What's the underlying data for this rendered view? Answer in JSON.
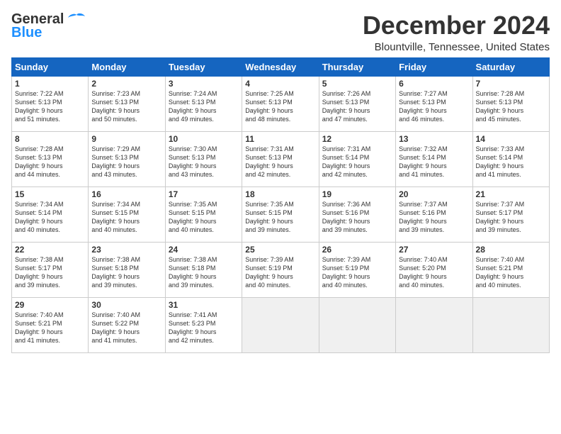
{
  "header": {
    "logo_line1": "General",
    "logo_line2": "Blue",
    "month_title": "December 2024",
    "location": "Blountville, Tennessee, United States"
  },
  "weekdays": [
    "Sunday",
    "Monday",
    "Tuesday",
    "Wednesday",
    "Thursday",
    "Friday",
    "Saturday"
  ],
  "days": [
    {
      "num": "",
      "info": ""
    },
    {
      "num": "",
      "info": ""
    },
    {
      "num": "",
      "info": ""
    },
    {
      "num": "",
      "info": ""
    },
    {
      "num": "",
      "info": ""
    },
    {
      "num": "",
      "info": ""
    },
    {
      "num": "1",
      "info": "Sunrise: 7:22 AM\nSunset: 5:13 PM\nDaylight: 9 hours\nand 51 minutes."
    },
    {
      "num": "2",
      "info": "Sunrise: 7:23 AM\nSunset: 5:13 PM\nDaylight: 9 hours\nand 50 minutes."
    },
    {
      "num": "3",
      "info": "Sunrise: 7:24 AM\nSunset: 5:13 PM\nDaylight: 9 hours\nand 49 minutes."
    },
    {
      "num": "4",
      "info": "Sunrise: 7:25 AM\nSunset: 5:13 PM\nDaylight: 9 hours\nand 48 minutes."
    },
    {
      "num": "5",
      "info": "Sunrise: 7:26 AM\nSunset: 5:13 PM\nDaylight: 9 hours\nand 47 minutes."
    },
    {
      "num": "6",
      "info": "Sunrise: 7:27 AM\nSunset: 5:13 PM\nDaylight: 9 hours\nand 46 minutes."
    },
    {
      "num": "7",
      "info": "Sunrise: 7:28 AM\nSunset: 5:13 PM\nDaylight: 9 hours\nand 45 minutes."
    },
    {
      "num": "8",
      "info": "Sunrise: 7:28 AM\nSunset: 5:13 PM\nDaylight: 9 hours\nand 44 minutes."
    },
    {
      "num": "9",
      "info": "Sunrise: 7:29 AM\nSunset: 5:13 PM\nDaylight: 9 hours\nand 43 minutes."
    },
    {
      "num": "10",
      "info": "Sunrise: 7:30 AM\nSunset: 5:13 PM\nDaylight: 9 hours\nand 43 minutes."
    },
    {
      "num": "11",
      "info": "Sunrise: 7:31 AM\nSunset: 5:13 PM\nDaylight: 9 hours\nand 42 minutes."
    },
    {
      "num": "12",
      "info": "Sunrise: 7:31 AM\nSunset: 5:14 PM\nDaylight: 9 hours\nand 42 minutes."
    },
    {
      "num": "13",
      "info": "Sunrise: 7:32 AM\nSunset: 5:14 PM\nDaylight: 9 hours\nand 41 minutes."
    },
    {
      "num": "14",
      "info": "Sunrise: 7:33 AM\nSunset: 5:14 PM\nDaylight: 9 hours\nand 41 minutes."
    },
    {
      "num": "15",
      "info": "Sunrise: 7:34 AM\nSunset: 5:14 PM\nDaylight: 9 hours\nand 40 minutes."
    },
    {
      "num": "16",
      "info": "Sunrise: 7:34 AM\nSunset: 5:15 PM\nDaylight: 9 hours\nand 40 minutes."
    },
    {
      "num": "17",
      "info": "Sunrise: 7:35 AM\nSunset: 5:15 PM\nDaylight: 9 hours\nand 40 minutes."
    },
    {
      "num": "18",
      "info": "Sunrise: 7:35 AM\nSunset: 5:15 PM\nDaylight: 9 hours\nand 39 minutes."
    },
    {
      "num": "19",
      "info": "Sunrise: 7:36 AM\nSunset: 5:16 PM\nDaylight: 9 hours\nand 39 minutes."
    },
    {
      "num": "20",
      "info": "Sunrise: 7:37 AM\nSunset: 5:16 PM\nDaylight: 9 hours\nand 39 minutes."
    },
    {
      "num": "21",
      "info": "Sunrise: 7:37 AM\nSunset: 5:17 PM\nDaylight: 9 hours\nand 39 minutes."
    },
    {
      "num": "22",
      "info": "Sunrise: 7:38 AM\nSunset: 5:17 PM\nDaylight: 9 hours\nand 39 minutes."
    },
    {
      "num": "23",
      "info": "Sunrise: 7:38 AM\nSunset: 5:18 PM\nDaylight: 9 hours\nand 39 minutes."
    },
    {
      "num": "24",
      "info": "Sunrise: 7:38 AM\nSunset: 5:18 PM\nDaylight: 9 hours\nand 39 minutes."
    },
    {
      "num": "25",
      "info": "Sunrise: 7:39 AM\nSunset: 5:19 PM\nDaylight: 9 hours\nand 40 minutes."
    },
    {
      "num": "26",
      "info": "Sunrise: 7:39 AM\nSunset: 5:19 PM\nDaylight: 9 hours\nand 40 minutes."
    },
    {
      "num": "27",
      "info": "Sunrise: 7:40 AM\nSunset: 5:20 PM\nDaylight: 9 hours\nand 40 minutes."
    },
    {
      "num": "28",
      "info": "Sunrise: 7:40 AM\nSunset: 5:21 PM\nDaylight: 9 hours\nand 40 minutes."
    },
    {
      "num": "29",
      "info": "Sunrise: 7:40 AM\nSunset: 5:21 PM\nDaylight: 9 hours\nand 41 minutes."
    },
    {
      "num": "30",
      "info": "Sunrise: 7:40 AM\nSunset: 5:22 PM\nDaylight: 9 hours\nand 41 minutes."
    },
    {
      "num": "31",
      "info": "Sunrise: 7:41 AM\nSunset: 5:23 PM\nDaylight: 9 hours\nand 42 minutes."
    }
  ]
}
